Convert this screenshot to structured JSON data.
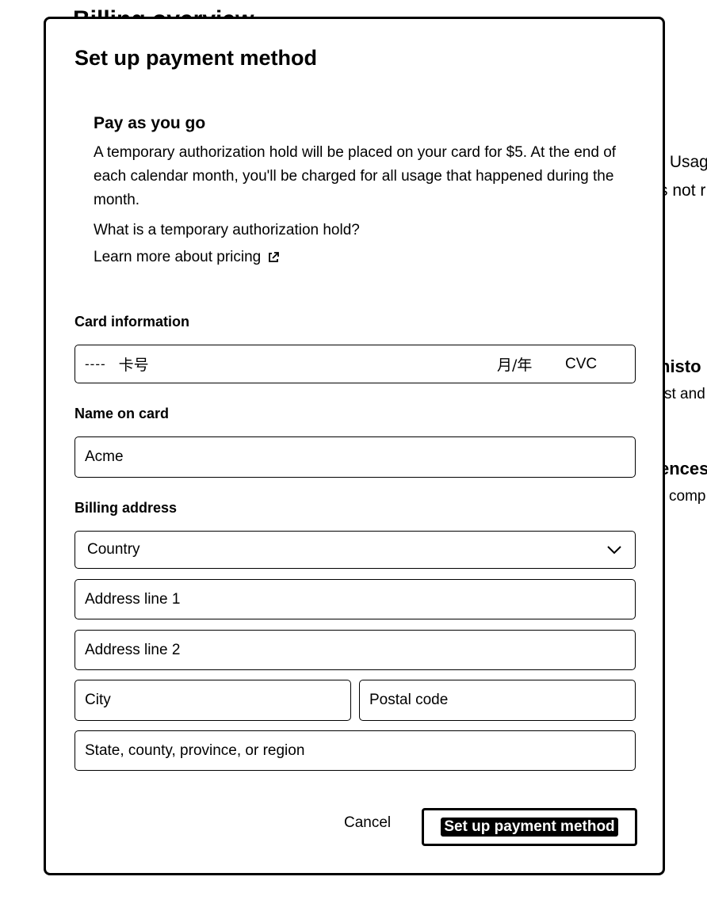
{
  "background": {
    "heading": "Billing overview",
    "fragments": [
      "r Usage",
      "s not r",
      "histo",
      "st and",
      "ences",
      "comp"
    ]
  },
  "modal": {
    "title": "Set up payment method",
    "info": {
      "title": "Pay as you go",
      "text": "A temporary authorization hold will be placed on your card for $5. At the end of each calendar month, you'll be charged for all usage that happened during the month.",
      "question": "What is a temporary authorization hold?",
      "link": "Learn more about pricing"
    },
    "card": {
      "label": "Card information",
      "dash": "----",
      "number_placeholder": "卡号",
      "expiry_placeholder": "月/年",
      "cvc_placeholder": "CVC"
    },
    "name": {
      "label": "Name on card",
      "value": "Acme"
    },
    "billing": {
      "label": "Billing address",
      "country_placeholder": "Country",
      "address1_placeholder": "Address line 1",
      "address2_placeholder": "Address line 2",
      "city_placeholder": "City",
      "postal_placeholder": "Postal code",
      "state_placeholder": "State, county, province, or region"
    },
    "actions": {
      "cancel": "Cancel",
      "submit": "Set up payment method"
    }
  }
}
